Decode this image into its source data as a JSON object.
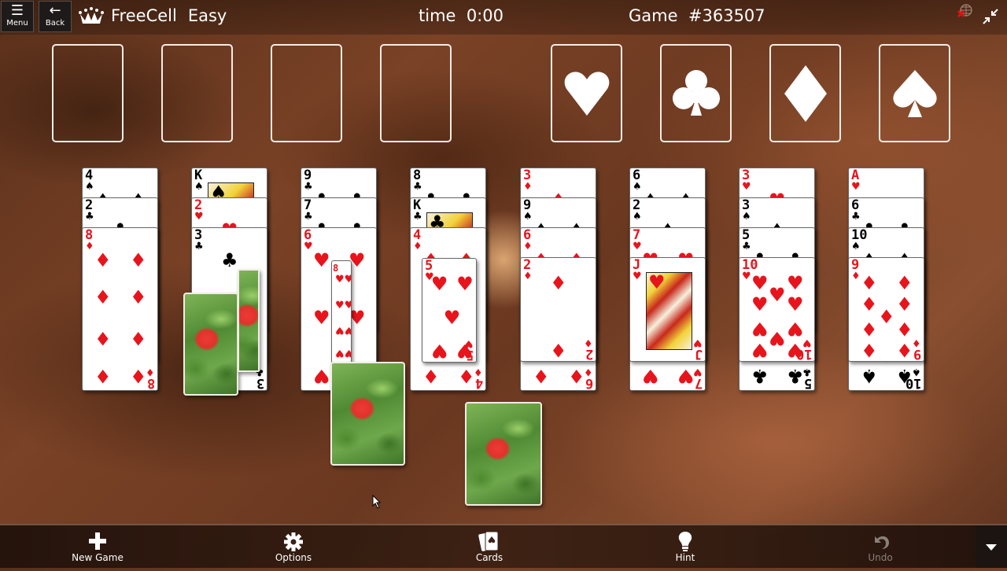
{
  "topbar": {
    "menu_label": "Menu",
    "back_label": "Back",
    "title": "FreeCell",
    "difficulty": "Easy",
    "time_label": "time",
    "time_value": "0:00",
    "game_label": "Game",
    "game_number": "#363507"
  },
  "freecells": [
    {
      "label": "free-cell-1",
      "card": null
    },
    {
      "label": "free-cell-2",
      "card": null
    },
    {
      "label": "free-cell-3",
      "card": null
    },
    {
      "label": "free-cell-4",
      "card": null
    }
  ],
  "foundations": [
    {
      "suit": "hearts",
      "glyph": "♥"
    },
    {
      "suit": "clubs",
      "glyph": "♣"
    },
    {
      "suit": "diamonds",
      "glyph": "♦"
    },
    {
      "suit": "spades",
      "glyph": "♠"
    }
  ],
  "tableau": [
    {
      "cards": [
        {
          "rank": "4",
          "suit": "♠"
        },
        {
          "rank": "2",
          "suit": "♣"
        },
        {
          "rank": "8",
          "suit": "♦"
        }
      ]
    },
    {
      "cards": [
        {
          "rank": "K",
          "suit": "♠"
        },
        {
          "rank": "2",
          "suit": "♥"
        },
        {
          "rank": "3",
          "suit": "♣"
        }
      ]
    },
    {
      "cards": [
        {
          "rank": "9",
          "suit": "♣"
        },
        {
          "rank": "7",
          "suit": "♣"
        },
        {
          "rank": "6",
          "suit": "♥"
        }
      ]
    },
    {
      "cards": [
        {
          "rank": "8",
          "suit": "♣"
        },
        {
          "rank": "K",
          "suit": "♣"
        },
        {
          "rank": "4",
          "suit": "♦"
        },
        {
          "rank": "5",
          "suit": "♥"
        }
      ]
    },
    {
      "cards": [
        {
          "rank": "3",
          "suit": "♦"
        },
        {
          "rank": "9",
          "suit": "♠"
        },
        {
          "rank": "6",
          "suit": "♦"
        },
        {
          "rank": "2",
          "suit": "♦"
        }
      ]
    },
    {
      "cards": [
        {
          "rank": "6",
          "suit": "♠"
        },
        {
          "rank": "2",
          "suit": "♠"
        },
        {
          "rank": "7",
          "suit": "♥"
        },
        {
          "rank": "J",
          "suit": "♥"
        }
      ]
    },
    {
      "cards": [
        {
          "rank": "3",
          "suit": "♥"
        },
        {
          "rank": "3",
          "suit": "♠"
        },
        {
          "rank": "5",
          "suit": "♣"
        },
        {
          "rank": "10",
          "suit": "♥"
        }
      ]
    },
    {
      "cards": [
        {
          "rank": "A",
          "suit": "♥"
        },
        {
          "rank": "6",
          "suit": "♣"
        },
        {
          "rank": "10",
          "suit": "♠"
        },
        {
          "rank": "9",
          "suit": "♦"
        }
      ]
    }
  ],
  "animating_cards": {
    "flipping_card": {
      "rank": "8",
      "suit": "♥"
    },
    "face_down_count": 4
  },
  "bottombar": {
    "new_game": "New Game",
    "options": "Options",
    "cards": "Cards",
    "hint": "Hint",
    "undo": "Undo"
  },
  "colors": {
    "red_suit": "#e8141c",
    "black_suit": "#000000",
    "slot_outline": "#f4ede6"
  }
}
